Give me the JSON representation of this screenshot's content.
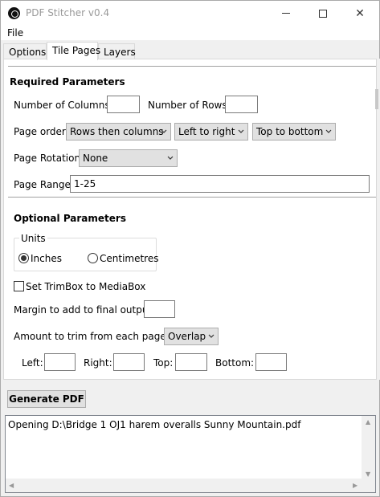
{
  "window": {
    "title": "PDF Stitcher v0.4",
    "minimize": "—",
    "close": "✕"
  },
  "menu": {
    "file": "File"
  },
  "tabs": [
    {
      "label": "Options",
      "active": false
    },
    {
      "label": "Tile Pages",
      "active": true
    },
    {
      "label": "Layers",
      "active": false
    }
  ],
  "required": {
    "heading": "Required Parameters",
    "num_columns_label": "Number of Columns:",
    "num_columns_value": "",
    "num_rows_label": "Number of Rows:",
    "num_rows_value": "",
    "page_order_label": "Page order:",
    "page_order_value": "Rows then columns",
    "direction_value": "Left to right",
    "vertical_value": "Top to bottom",
    "rotation_label": "Page Rotation:",
    "rotation_value": "None",
    "range_label": "Page Range:",
    "range_value": "1-25"
  },
  "optional": {
    "heading": "Optional Parameters",
    "units_title": "Units",
    "units_inches": "Inches",
    "units_cm": "Centimetres",
    "units_selected": "Inches",
    "trimbox_label": "Set TrimBox to MediaBox",
    "trimbox_checked": false,
    "margin_label": "Margin to add to final output:",
    "margin_value": "",
    "trim_label": "Amount to trim from each page:",
    "trim_value": "Overlap",
    "left_label": "Left:",
    "right_label": "Right:",
    "top_label": "Top:",
    "bottom_label": "Bottom:"
  },
  "generate_label": "Generate PDF",
  "log_text": "Opening D:\\Bridge 1 OJ1 harem overalls Sunny Mountain.pdf",
  "icons": {
    "app": "app-logo-icon",
    "dropdown": "chevron-down-icon"
  },
  "colors": {
    "window_bg": "#f0f0f0",
    "panel_bg": "#ffffff",
    "button_bg": "#e1e1e1"
  }
}
